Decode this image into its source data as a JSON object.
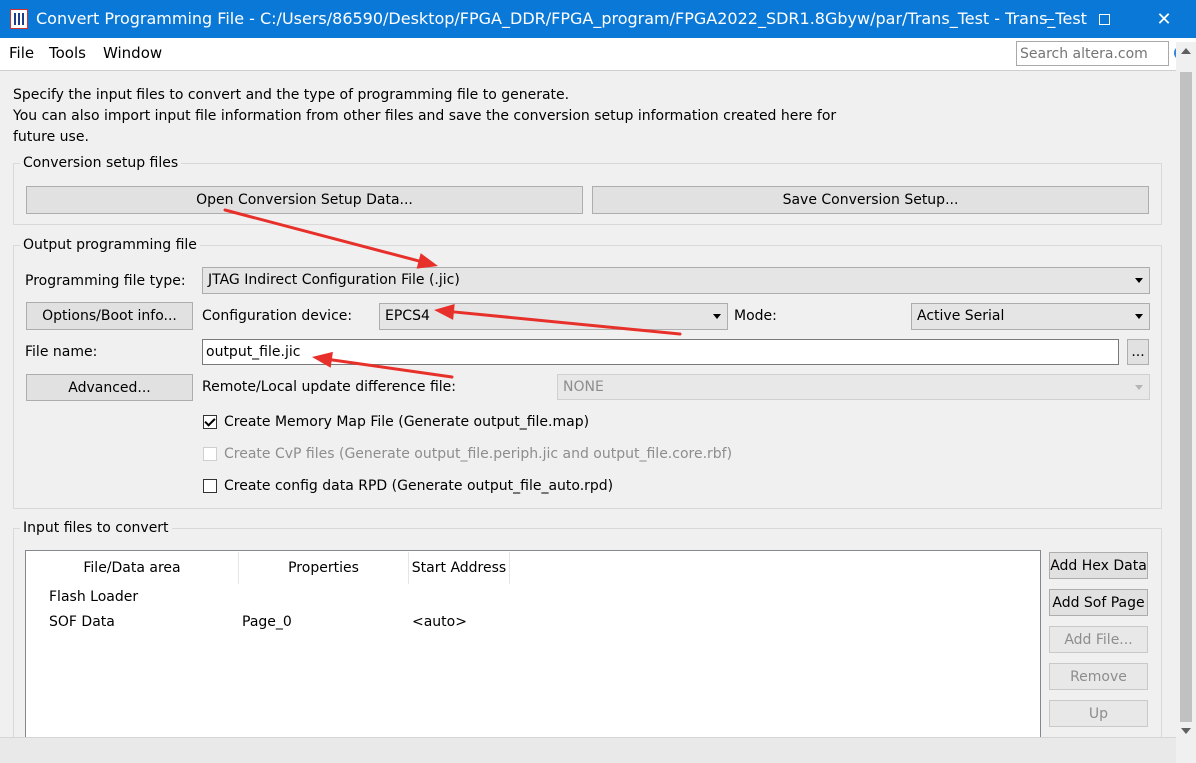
{
  "window": {
    "title": "Convert Programming File - C:/Users/86590/Desktop/FPGA_DDR/FPGA_program/FPGA2022_SDR1.8Gbyw/par/Trans_Test - Trans_Test",
    "close_glyph": "✕"
  },
  "menu": {
    "file": "File",
    "tools": "Tools",
    "window": "Window"
  },
  "search": {
    "placeholder": "Search altera.com"
  },
  "intro": {
    "line1": "Specify the input files to convert and the type of programming file to generate.",
    "line2": "You can also import input file information from other files and save the conversion setup information created here for future use."
  },
  "setup_group": {
    "label": "Conversion setup files",
    "open_button": "Open Conversion Setup Data...",
    "save_button": "Save Conversion Setup..."
  },
  "output_group": {
    "label": "Output programming file",
    "file_type_label": "Programming file type:",
    "file_type_value": "JTAG Indirect Configuration File (.jic)",
    "options_button": "Options/Boot info...",
    "config_device_label": "Configuration device:",
    "config_device_value": "EPCS4",
    "mode_label": "Mode:",
    "mode_value": "Active Serial",
    "file_name_label": "File name:",
    "file_name_value": "output_file.jic",
    "browse_button": "...",
    "advanced_button": "Advanced...",
    "remote_label": "Remote/Local update difference file:",
    "remote_value": "NONE",
    "chk_memory_map": "Create Memory Map File (Generate output_file.map)",
    "chk_cvp": "Create CvP files (Generate output_file.periph.jic and output_file.core.rbf)",
    "chk_rpd": "Create config data RPD (Generate output_file_auto.rpd)"
  },
  "input_group": {
    "label": "Input files to convert",
    "columns": [
      "File/Data area",
      "Properties",
      "Start Address"
    ],
    "rows": [
      {
        "area": "Flash Loader",
        "properties": "",
        "address": ""
      },
      {
        "area": "SOF Data",
        "properties": "Page_0",
        "address": "<auto>"
      }
    ],
    "buttons": {
      "add_hex": "Add Hex Data",
      "add_sof": "Add Sof Page",
      "add_file": "Add File...",
      "remove": "Remove",
      "up": "Up"
    }
  },
  "colors": {
    "titlebar": "#0a78d7",
    "annotation_arrow": "#e8302a"
  }
}
